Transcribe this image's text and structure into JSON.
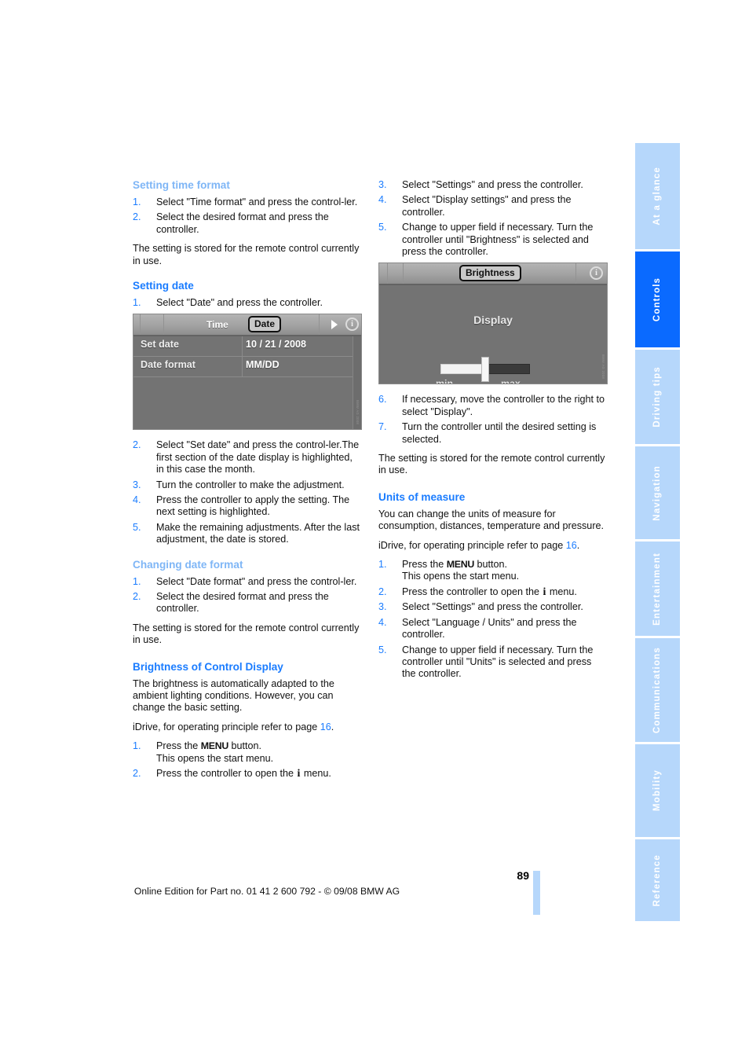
{
  "document": {
    "page_number": "89",
    "footer": "Online Edition for Part no. 01 41 2 600 792 - © 09/08 BMW AG"
  },
  "sidebar": {
    "tabs": [
      {
        "label": "At a glance",
        "active": false
      },
      {
        "label": "Controls",
        "active": true
      },
      {
        "label": "Driving tips",
        "active": false
      },
      {
        "label": "Navigation",
        "active": false
      },
      {
        "label": "Entertainment",
        "active": false
      },
      {
        "label": "Communications",
        "active": false
      },
      {
        "label": "Mobility",
        "active": false
      },
      {
        "label": "Reference",
        "active": false
      }
    ],
    "colors": {
      "active": "#0a6aff",
      "inactive": "#b6d7fb",
      "label": "#ffffff"
    }
  },
  "colors": {
    "heading_blue": "#1a7cff",
    "heading_blue_pale": "#7fb6f6",
    "step_number_blue": "#1a7cff",
    "page_reference_blue": "#1a7cff"
  },
  "left_column": {
    "section_time_format": {
      "heading": "Setting time format",
      "steps": [
        {
          "num": "1.",
          "text": "Select \"Time format\" and press the control-ler."
        },
        {
          "num": "2.",
          "text": "Select the desired format and press the controller."
        }
      ],
      "note": "The setting is stored for the remote control currently in use."
    },
    "section_setting_date": {
      "heading": "Setting date",
      "steps_before_image": [
        {
          "num": "1.",
          "text": "Select \"Date\" and press the controller."
        }
      ],
      "steps_after_image": [
        {
          "num": "2.",
          "text": "Select \"Set date\" and press the control-ler.The first section of the date display is highlighted, in this case the month."
        },
        {
          "num": "3.",
          "text": "Turn the controller to make the adjustment."
        },
        {
          "num": "4.",
          "text": "Press the controller to apply the setting. The next setting is highlighted."
        },
        {
          "num": "5.",
          "text": "Make the remaining adjustments. After the last adjustment, the date is stored."
        }
      ]
    },
    "section_changing_date_format": {
      "heading": "Changing date format",
      "steps": [
        {
          "num": "1.",
          "text": "Select \"Date format\" and press the control-ler."
        },
        {
          "num": "2.",
          "text": "Select the desired format and press the controller."
        }
      ],
      "note": "The setting is stored for the remote control currently in use."
    },
    "section_brightness": {
      "heading": "Brightness of Control Display",
      "intro": "The brightness is automatically adapted to the ambient lighting conditions. However, you can change the basic setting.",
      "idrive_ref_prefix": "iDrive, for operating principle refer to page ",
      "idrive_ref_page": "16",
      "idrive_ref_suffix": ".",
      "steps": [
        {
          "num": "1.",
          "pre": "Press the ",
          "key": "MENU",
          "post": " button.",
          "second_line": "This opens the start menu."
        },
        {
          "num": "2.",
          "pre": "Press the controller to open the ",
          "key": "i",
          "post": " menu."
        }
      ]
    }
  },
  "right_column": {
    "brightness_steps_top": [
      {
        "num": "3.",
        "text": "Select \"Settings\" and press the controller."
      },
      {
        "num": "4.",
        "text": "Select \"Display settings\" and press the controller."
      },
      {
        "num": "5.",
        "text": "Change to upper field if necessary. Turn the controller until \"Brightness\" is selected and press the controller."
      }
    ],
    "brightness_steps_bottom": [
      {
        "num": "6.",
        "text": "If necessary, move the controller to the right to select \"Display\"."
      },
      {
        "num": "7.",
        "text": "Turn the controller until the desired setting is selected."
      }
    ],
    "brightness_note": "The setting is stored for the remote control currently in use.",
    "section_units": {
      "heading": "Units of measure",
      "intro": "You can change the units of measure for consumption, distances, temperature and pressure.",
      "idrive_ref_prefix": "iDrive, for operating principle refer to page ",
      "idrive_ref_page": "16",
      "idrive_ref_suffix": ".",
      "steps": [
        {
          "num": "1.",
          "pre": "Press the ",
          "key": "MENU",
          "post": " button.",
          "second_line": "This opens the start menu."
        },
        {
          "num": "2.",
          "pre": "Press the controller to open the ",
          "key": "i",
          "post": " menu."
        },
        {
          "num": "3.",
          "text": "Select \"Settings\" and press the controller."
        },
        {
          "num": "4.",
          "text": "Select \"Language / Units\" and press the controller."
        },
        {
          "num": "5.",
          "text": "Change to upper field if necessary. Turn the controller until \"Units\" is selected and press the controller."
        }
      ]
    }
  },
  "idrive_date_screen": {
    "tab_unselected": "Time",
    "tab_selected": "Date",
    "icon_next": "triangle-right-icon",
    "icon_info": "info-circle-icon",
    "rows": [
      {
        "label": "Set date",
        "value": "10 / 21 / 2008"
      },
      {
        "label": "Date format",
        "value": "MM/DD"
      }
    ],
    "watermark": "BMW AG 2008"
  },
  "idrive_brightness_screen": {
    "title_tab": "Brightness",
    "icon_info": "info-circle-icon",
    "heading": "Display",
    "slider_min_label": "min.",
    "slider_max_label": "max.",
    "slider_value_percent": 50,
    "watermark": "BMW AG 2008"
  }
}
